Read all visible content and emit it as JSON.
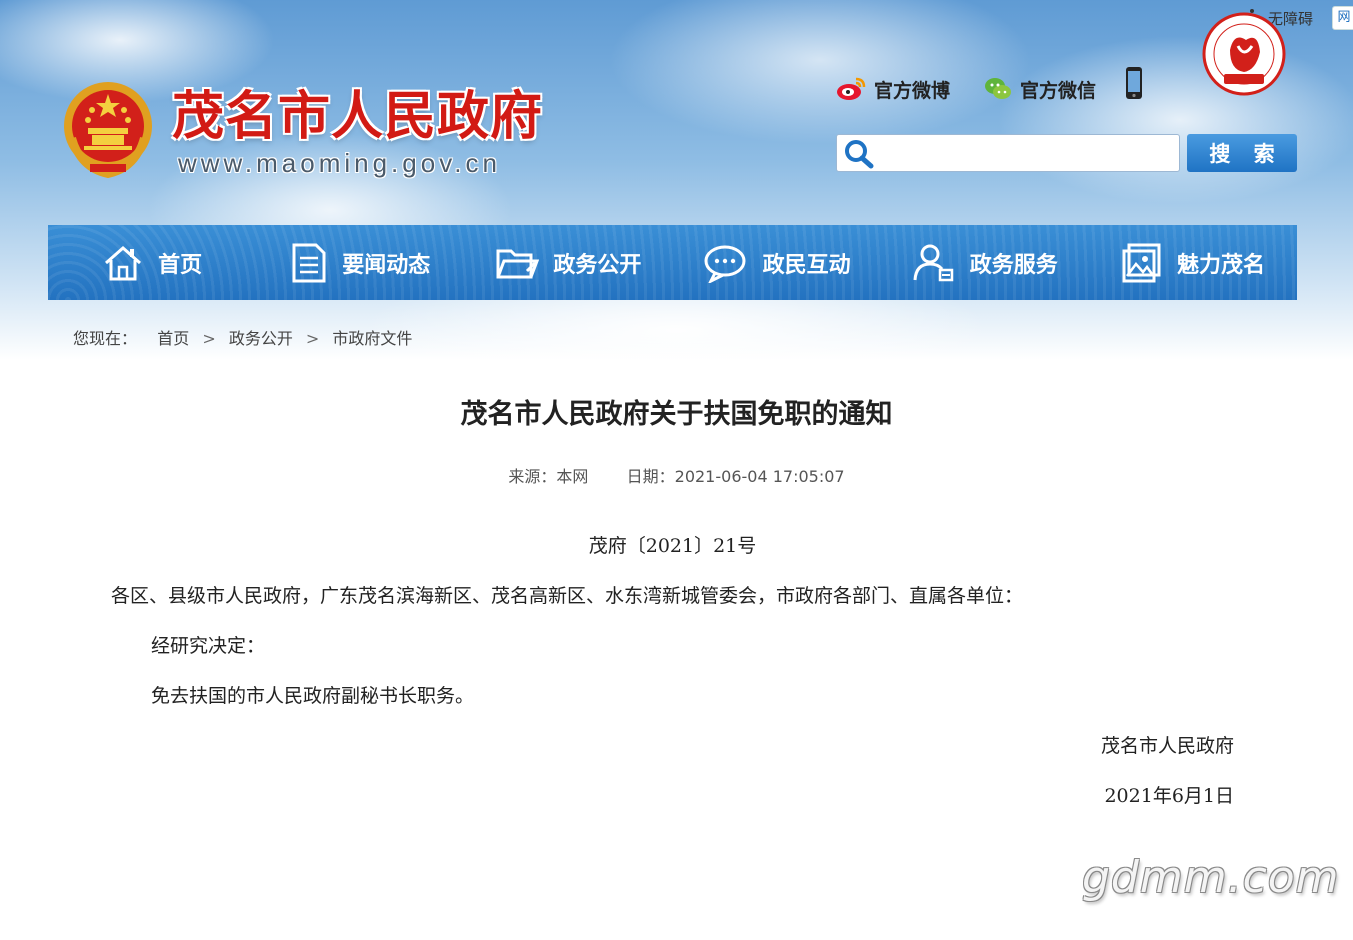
{
  "header": {
    "site_title": "茂名市人民政府",
    "site_url": "www.maoming.gov.cn",
    "accessibility_label": "无障碍",
    "edge_label": "网",
    "weibo_label": "官方微博",
    "weixin_label": "官方微信",
    "search": {
      "placeholder": "",
      "button_label": "搜 索"
    }
  },
  "nav": [
    {
      "label": "首页",
      "icon": "home-icon"
    },
    {
      "label": "要闻动态",
      "icon": "document-icon"
    },
    {
      "label": "政务公开",
      "icon": "folder-icon"
    },
    {
      "label": "政民互动",
      "icon": "chat-icon"
    },
    {
      "label": "政务服务",
      "icon": "user-service-icon"
    },
    {
      "label": "魅力茂名",
      "icon": "picture-icon"
    }
  ],
  "breadcrumb": {
    "prefix": "您现在：",
    "items": [
      "首页",
      "政务公开",
      "市政府文件"
    ],
    "sep": ">"
  },
  "article": {
    "title": "茂名市人民政府关于扶国免职的通知",
    "source": "来源：本网",
    "date_label": "日期：",
    "date": "2021-06-04 17:05:07",
    "doc_number": "茂府〔2021〕21号",
    "recipients": "各区、县级市人民政府，广东茂名滨海新区、茂名高新区、水东湾新城管委会，市政府各部门、直属各单位：",
    "decision_intro": "经研究决定：",
    "decision": "免去扶国的市人民政府副秘书长职务。",
    "signature": "茂名市人民政府",
    "sign_date": "2021年6月1日"
  },
  "watermark": "gdmm.com",
  "colors": {
    "title_red": "#d21a14",
    "nav_blue": "#2a7bc8",
    "search_blue": "#1f73c4"
  }
}
